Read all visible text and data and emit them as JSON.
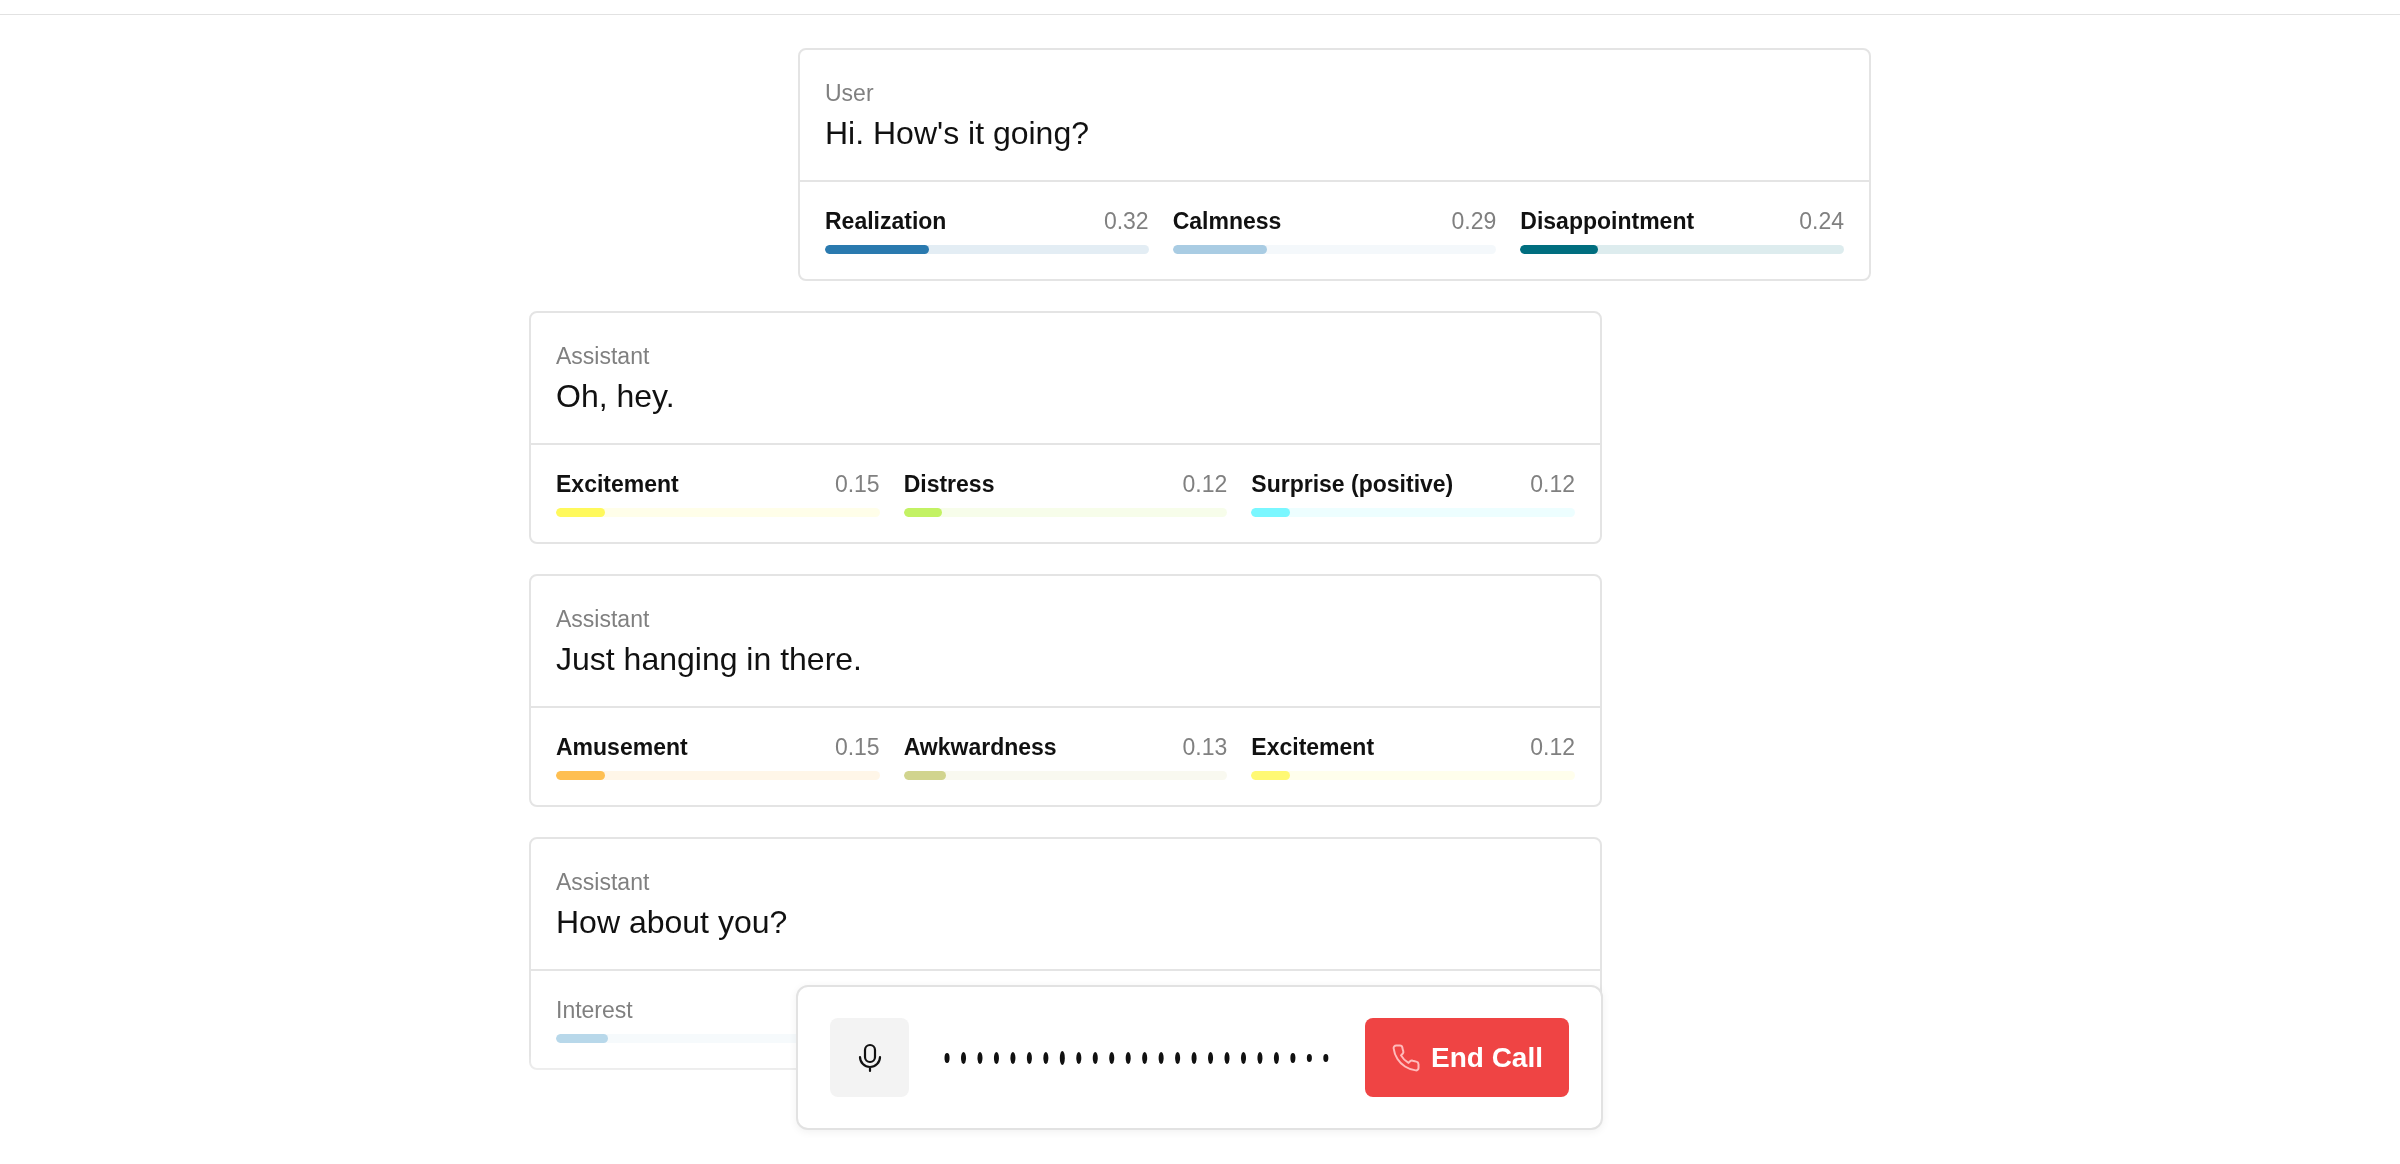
{
  "messages": [
    {
      "role": "User",
      "kind": "user",
      "text": "Hi. How's it going?",
      "emotions": [
        {
          "name": "Realization",
          "score": "0.32",
          "level": 0.32,
          "color": "#2a7aaf"
        },
        {
          "name": "Calmness",
          "score": "0.29",
          "level": 0.29,
          "color": "#a9cce3"
        },
        {
          "name": "Disappointment",
          "score": "0.24",
          "level": 0.24,
          "color": "#006e7f"
        }
      ]
    },
    {
      "role": "Assistant",
      "kind": "assistant",
      "text": "Oh, hey.",
      "emotions": [
        {
          "name": "Excitement",
          "score": "0.15",
          "level": 0.15,
          "color": "#fff95c"
        },
        {
          "name": "Distress",
          "score": "0.12",
          "level": 0.12,
          "color": "#c3f264"
        },
        {
          "name": "Surprise (positive)",
          "score": "0.12",
          "level": 0.12,
          "color": "#7af7ff"
        }
      ]
    },
    {
      "role": "Assistant",
      "kind": "assistant",
      "text": "Just hanging in there.",
      "emotions": [
        {
          "name": "Amusement",
          "score": "0.15",
          "level": 0.15,
          "color": "#febf52"
        },
        {
          "name": "Awkwardness",
          "score": "0.13",
          "level": 0.13,
          "color": "#d1d48e"
        },
        {
          "name": "Excitement",
          "score": "0.12",
          "level": 0.12,
          "color": "#fff974"
        }
      ]
    },
    {
      "role": "Assistant",
      "kind": "assistant",
      "text": "How about you?",
      "emotions": [
        {
          "name": "Interest",
          "level": 0.16,
          "color": "#b8d8ea"
        }
      ]
    }
  ],
  "call_controls": {
    "muted": false,
    "end_button": "End Call"
  }
}
